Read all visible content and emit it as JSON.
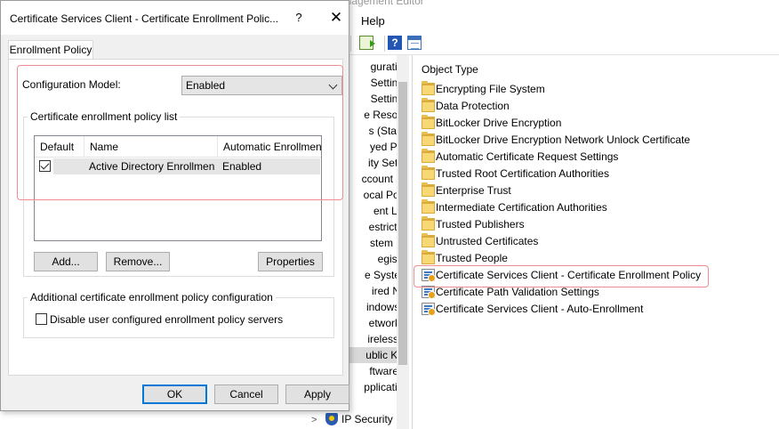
{
  "background_window": {
    "title": "Group Policy Management Editor",
    "menu_help": "Help",
    "tree_items": [
      "guration",
      "Settings",
      "Settings",
      "e Resolut",
      "s (Startu",
      "yed Prin",
      "ity Settin",
      "ccount Po",
      "ocal Polic",
      "ent Log",
      "estricted",
      "stem Se",
      "egistry",
      "e System",
      "ired Net",
      "indows F",
      "etwork L",
      "ireless N",
      "ublic Key",
      "ftware R",
      "pplication"
    ],
    "tree_ipsec": "IP Security",
    "list_header": "Object Type",
    "list_items": [
      {
        "label": "Encrypting File System",
        "icon": "folder-icon"
      },
      {
        "label": "Data Protection",
        "icon": "folder-icon"
      },
      {
        "label": "BitLocker Drive Encryption",
        "icon": "folder-icon"
      },
      {
        "label": "BitLocker Drive Encryption Network Unlock Certificate",
        "icon": "folder-icon"
      },
      {
        "label": "Automatic Certificate Request Settings",
        "icon": "folder-icon"
      },
      {
        "label": "Trusted Root Certification Authorities",
        "icon": "folder-icon"
      },
      {
        "label": "Enterprise Trust",
        "icon": "folder-icon"
      },
      {
        "label": "Intermediate Certification Authorities",
        "icon": "folder-icon"
      },
      {
        "label": "Trusted Publishers",
        "icon": "folder-icon"
      },
      {
        "label": "Untrusted Certificates",
        "icon": "folder-icon"
      },
      {
        "label": "Trusted People",
        "icon": "folder-icon"
      },
      {
        "label": "Certificate Services Client - Certificate Enrollment Policy",
        "icon": "policy-icon"
      },
      {
        "label": "Certificate Path Validation Settings",
        "icon": "policy-icon"
      },
      {
        "label": "Certificate Services Client - Auto-Enrollment",
        "icon": "policy-icon"
      }
    ]
  },
  "dialog": {
    "title": "Certificate Services Client - Certificate Enrollment Polic...",
    "help_glyph": "?",
    "close_glyph": "✕",
    "tab_label": "Enrollment Policy",
    "config_model_label": "Configuration Model:",
    "config_model_value": "Enabled",
    "policy_list_label": "Certificate enrollment policy list",
    "columns": [
      "Default",
      "Name",
      "Automatic Enrollment"
    ],
    "rows": [
      {
        "default_checked": true,
        "name": "Active Directory Enrollmen...",
        "auto_enrollment": "Enabled"
      }
    ],
    "add_button": "Add...",
    "remove_button": "Remove...",
    "properties_button": "Properties",
    "additional_label": "Additional certificate enrollment policy configuration",
    "disable_servers_label": "Disable user configured enrollment policy servers",
    "disable_servers_checked": false,
    "ok_button": "OK",
    "cancel_button": "Cancel",
    "apply_button": "Apply"
  },
  "colors": {
    "highlight": "#ee8d92",
    "default_button_border": "#0078d7"
  }
}
